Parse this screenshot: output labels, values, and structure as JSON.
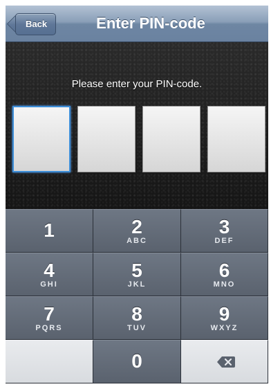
{
  "navbar": {
    "back_label": "Back",
    "title": "Enter PIN-code"
  },
  "content": {
    "prompt": "Please enter your PIN-code.",
    "pin_boxes": 4,
    "active_box": 1
  },
  "keypad": {
    "keys": [
      {
        "digit": "1",
        "letters": ""
      },
      {
        "digit": "2",
        "letters": "ABC"
      },
      {
        "digit": "3",
        "letters": "DEF"
      },
      {
        "digit": "4",
        "letters": "GHI"
      },
      {
        "digit": "5",
        "letters": "JKL"
      },
      {
        "digit": "6",
        "letters": "MNO"
      },
      {
        "digit": "7",
        "letters": "PQRS"
      },
      {
        "digit": "8",
        "letters": "TUV"
      },
      {
        "digit": "9",
        "letters": "WXYZ"
      },
      {
        "digit": "0",
        "letters": ""
      }
    ],
    "delete_icon": "backspace-icon"
  },
  "colors": {
    "active_border": "#3d8ed8",
    "key_dark": "#5a626e",
    "key_light": "#d8dbdf"
  }
}
